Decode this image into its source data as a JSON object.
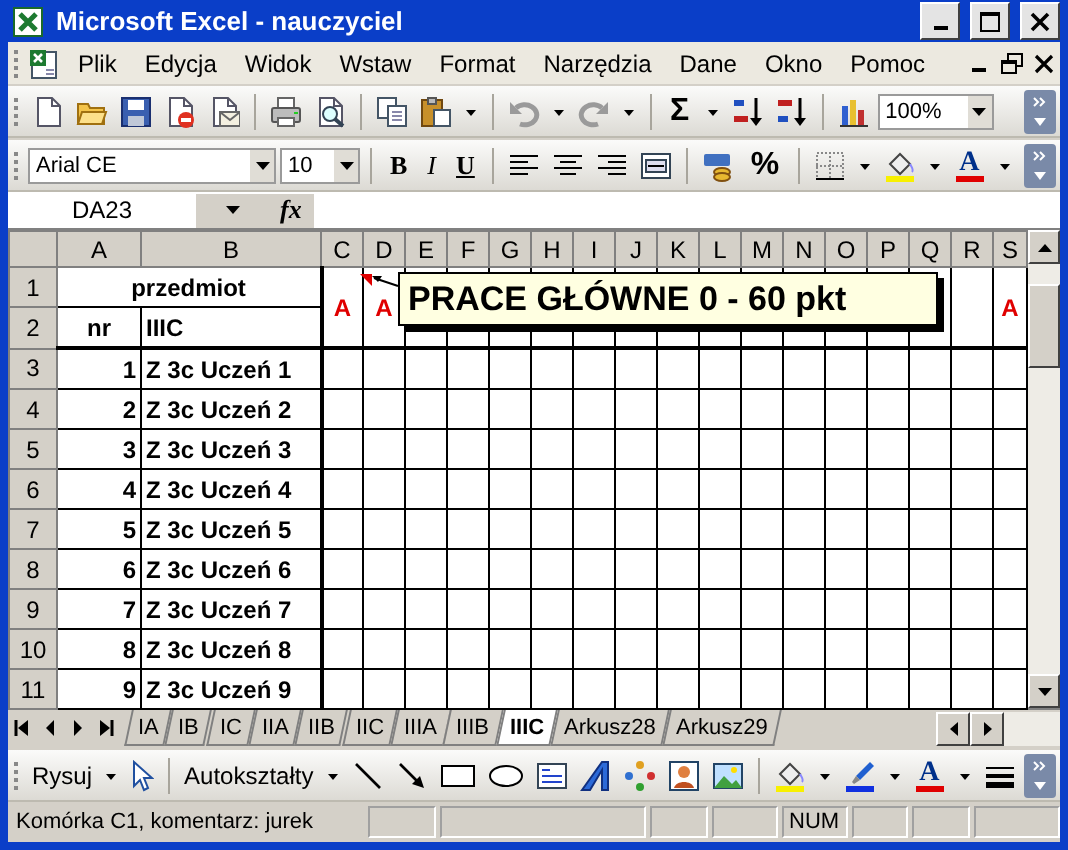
{
  "window": {
    "title": "Microsoft Excel - nauczyciel"
  },
  "menu": [
    "Plik",
    "Edycja",
    "Widok",
    "Wstaw",
    "Format",
    "Narzędzia",
    "Dane",
    "Okno",
    "Pomoc"
  ],
  "standard_toolbar": {
    "autosum": "Σ",
    "zoom": "100%"
  },
  "format_toolbar": {
    "font": "Arial CE",
    "size": "10",
    "styles": [
      "B",
      "I",
      "U"
    ],
    "percent": "%",
    "font_color": "A"
  },
  "formula_bar": {
    "name_box": "DA23",
    "function_label": "fx"
  },
  "sheet": {
    "columns": [
      "A",
      "B",
      "C",
      "D",
      "E",
      "F",
      "G",
      "H",
      "I",
      "J",
      "K",
      "L",
      "M",
      "N",
      "O",
      "P",
      "Q",
      "R",
      "S"
    ],
    "row_numbers": [
      "1",
      "2",
      "3",
      "4",
      "5",
      "6",
      "7",
      "8",
      "9",
      "10",
      "11"
    ],
    "subject": "przedmiot",
    "nr_label": "nr",
    "class_label": "IIIC",
    "marks": {
      "c": "A",
      "d": "A",
      "s": "A"
    },
    "students": [
      {
        "nr": "1",
        "name": "Z 3c Uczeń 1"
      },
      {
        "nr": "2",
        "name": "Z 3c Uczeń 2"
      },
      {
        "nr": "3",
        "name": "Z 3c Uczeń 3"
      },
      {
        "nr": "4",
        "name": "Z 3c Uczeń 4"
      },
      {
        "nr": "5",
        "name": "Z 3c Uczeń 5"
      },
      {
        "nr": "6",
        "name": "Z 3c Uczeń 6"
      },
      {
        "nr": "7",
        "name": "Z 3c Uczeń 7"
      },
      {
        "nr": "8",
        "name": "Z 3c Uczeń 8"
      },
      {
        "nr": "9",
        "name": "Z 3c Uczeń 9"
      }
    ]
  },
  "comment": {
    "text": "PRACE GŁÓWNE 0 - 60 pkt"
  },
  "sheet_tabs": [
    {
      "label": "IA",
      "selected": false
    },
    {
      "label": "IB",
      "selected": false
    },
    {
      "label": "IC",
      "selected": false
    },
    {
      "label": "IIA",
      "selected": false
    },
    {
      "label": "IIB",
      "selected": false
    },
    {
      "label": "IIC",
      "selected": false
    },
    {
      "label": "IIIA",
      "selected": false
    },
    {
      "label": "IIIB",
      "selected": false
    },
    {
      "label": "IIIC",
      "selected": true
    },
    {
      "label": "Arkusz28",
      "selected": false
    },
    {
      "label": "Arkusz29",
      "selected": false
    }
  ],
  "drawing_toolbar": {
    "draw": "Rysuj",
    "autoshapes": "Autokształty",
    "font_color": "A"
  },
  "status_bar": {
    "text": "Komórka C1, komentarz: jurek",
    "indicator": "NUM"
  }
}
